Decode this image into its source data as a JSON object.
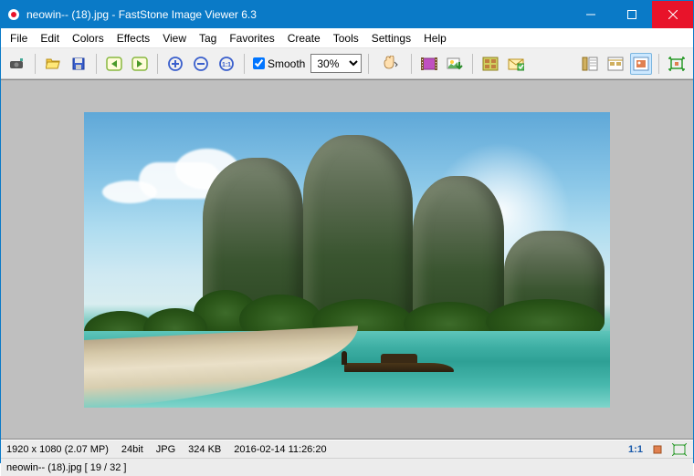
{
  "titlebar": {
    "title": "neowin-- (18).jpg  -  FastStone Image Viewer 6.3"
  },
  "menu": {
    "file": "File",
    "edit": "Edit",
    "colors": "Colors",
    "effects": "Effects",
    "view": "View",
    "tag": "Tag",
    "favorites": "Favorites",
    "create": "Create",
    "tools": "Tools",
    "settings": "Settings",
    "help": "Help"
  },
  "toolbar": {
    "smooth_label": "Smooth",
    "smooth_checked": true,
    "zoom_value": "30%"
  },
  "status": {
    "dimensions": "1920 x 1080 (2.07 MP)",
    "depth": "24bit",
    "format": "JPG",
    "filesize": "324 KB",
    "datetime": "2016-02-14 11:26:20",
    "ratio_label": "1:1",
    "filename_position": "neowin-- (18).jpg [ 19 / 32 ]"
  }
}
